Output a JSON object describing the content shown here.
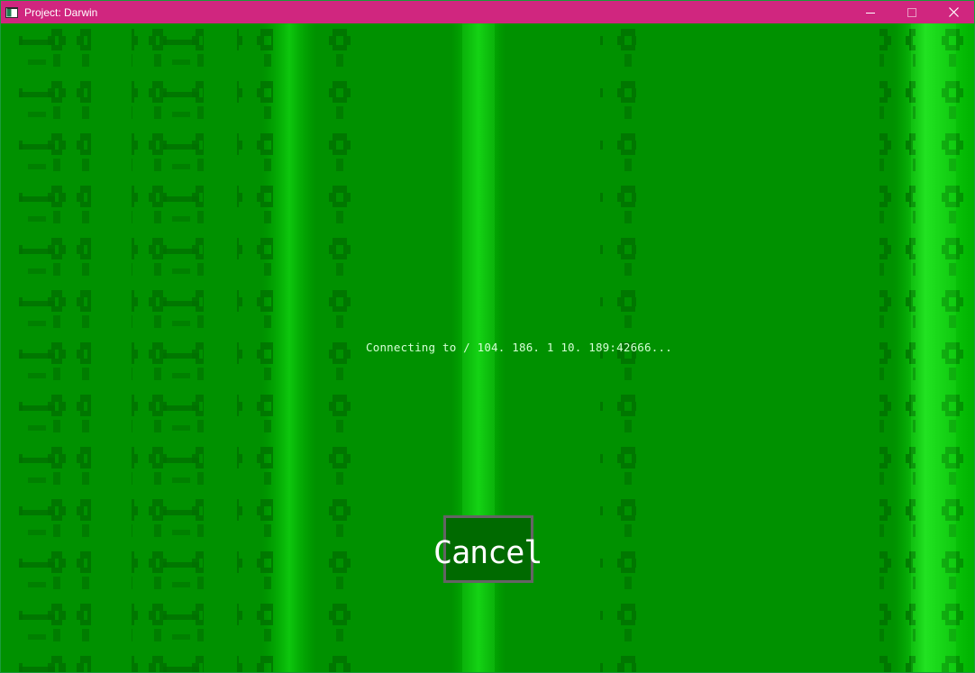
{
  "window": {
    "title": "Project: Darwin",
    "icon": "app-window-icon",
    "controls": {
      "minimize_icon": "minimize-icon",
      "maximize_icon": "maximize-icon",
      "close_icon": "close-icon"
    },
    "titlebar_color": "#d0267f"
  },
  "game": {
    "background_color": "#009100",
    "status_message": "Connecting to / 104. 186. 1 10. 189:42666...",
    "cancel_button_label": "Cancel",
    "button_fill_color": "#006a00",
    "button_border_color": "#646464"
  }
}
